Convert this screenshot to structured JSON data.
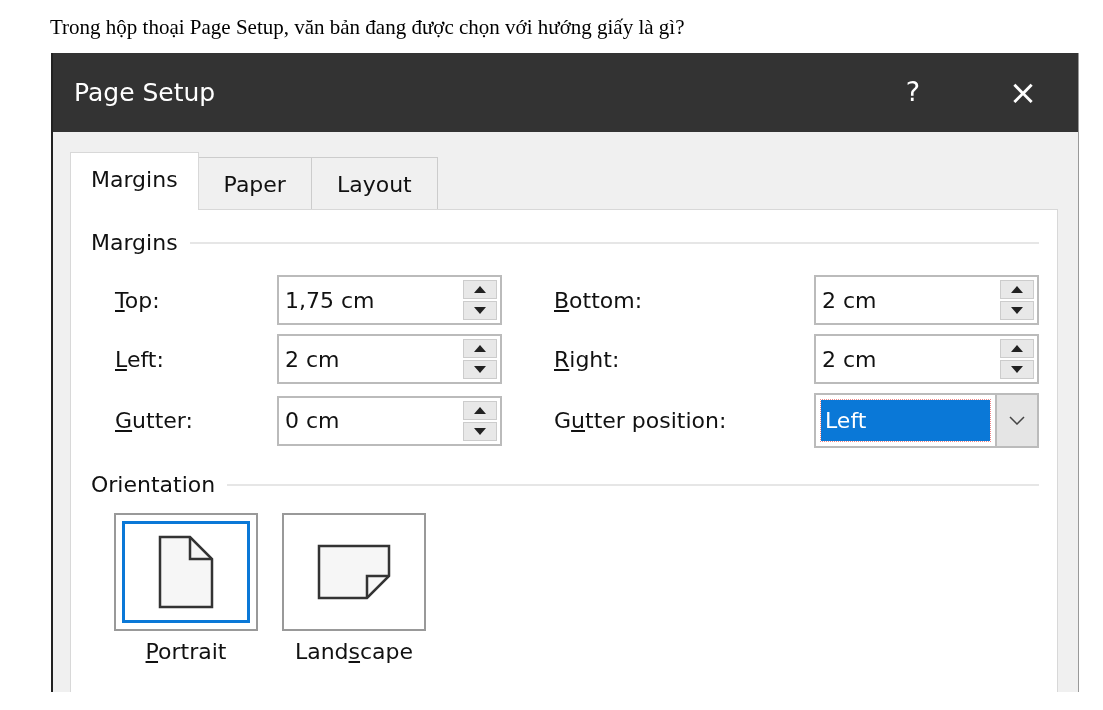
{
  "question": "Trong hộp thoại Page Setup, văn bản đang được chọn với hướng giấy là gì?",
  "window": {
    "title": "Page Setup",
    "buttons": [
      {
        "kind": "help",
        "label": "?"
      },
      {
        "kind": "close",
        "label": "×"
      }
    ]
  },
  "tabs": [
    {
      "label": "Margins",
      "selected": true
    },
    {
      "label": "Paper",
      "selected": false
    },
    {
      "label": "Layout",
      "selected": false
    }
  ],
  "margins": {
    "heading": "Margins",
    "fields": [
      {
        "kind": "spin",
        "key": "T",
        "after": "op:",
        "value": "1,75 cm"
      },
      {
        "kind": "spin",
        "key": "B",
        "after": "ottom:",
        "value": "2 cm"
      },
      {
        "kind": "spin",
        "key": "L",
        "after": "eft:",
        "value": "2 cm"
      },
      {
        "kind": "spin",
        "key": "R",
        "after": "ight:",
        "value": "2 cm"
      },
      {
        "kind": "spin",
        "key": "G",
        "after": "utter:",
        "value": "0 cm"
      },
      {
        "kind": "dropdown",
        "before": "G",
        "key": "u",
        "after": "tter position:",
        "value": "Left",
        "focused": true
      }
    ]
  },
  "orientation": {
    "heading": "Orientation",
    "options": [
      {
        "kind": "portrait",
        "key": "P",
        "after": "ortrait",
        "selected": true
      },
      {
        "kind": "landscape",
        "before": "Land",
        "key": "s",
        "after": "cape",
        "selected": false
      }
    ]
  }
}
